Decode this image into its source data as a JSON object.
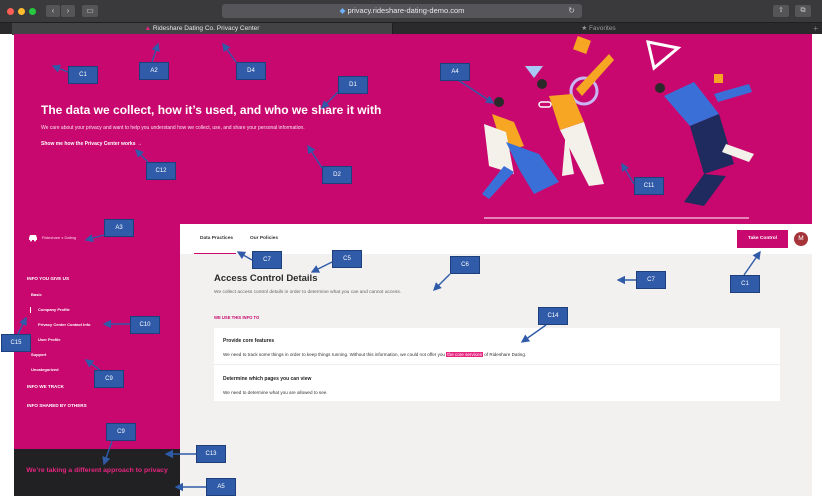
{
  "browser": {
    "url": "privacy.rideshare-dating-demo.com",
    "tab_title": "Rideshare Dating Co. Privacy Center",
    "favorites_label": "Favorites",
    "colors": {
      "chrome": "#3a3a3c",
      "tabbar": "#2a2a2c"
    }
  },
  "theme": {
    "brand": "#c8086e",
    "dark": "#212124",
    "panel": "#f3f1ef",
    "badge": "#2f5ba8"
  },
  "hero": {
    "title": "The data we collect, how it’s used, and who we share it with",
    "subtitle": "We care about your privacy and want to help you understand how we collect, use, and share your personal information.",
    "link": "Show me how the Privacy Center works →"
  },
  "sidebar": {
    "brand": "Rideshare x Dating",
    "sections": [
      {
        "label": "INFO YOU GIVE US"
      },
      {
        "label": "INFO WE TRACK"
      },
      {
        "label": "INFO SHARED BY OTHERS"
      }
    ],
    "items": [
      {
        "label": "Basic"
      },
      {
        "label": "Company Profile"
      },
      {
        "label": "Privacy Center Contact Info"
      },
      {
        "label": "User Profile"
      },
      {
        "label": "Support"
      },
      {
        "label": "Uncategorized"
      }
    ],
    "approach": "We’re taking a different approach to privacy"
  },
  "main": {
    "tabs": [
      {
        "label": "Data Practices",
        "active": true
      },
      {
        "label": "Our Policies",
        "active": false
      }
    ],
    "take_control": "Take Control",
    "avatar_letter": "M",
    "section_title": "Access Control Details",
    "section_desc": "We collect access control details in order to determine what you can and cannot access.",
    "we_use_label": "WE USE THIS INFO TO",
    "uses": [
      {
        "title": "Provide core features",
        "text_before": "We need to track some things in order to keep things running. Without this information, we could not offer you ",
        "highlight": "the core services",
        "text_after": " of Rideshare Dating."
      },
      {
        "title": "Determine which pages you can view",
        "text": "We need to determine what you are allowed to see."
      }
    ]
  },
  "annotations": [
    "C1",
    "A2",
    "D4",
    "D1",
    "A4",
    "C12",
    "D2",
    "C11",
    "A3",
    "C7",
    "C5",
    "C6",
    "C7",
    "C1",
    "C14",
    "C10",
    "C15",
    "C9",
    "C9",
    "C13",
    "A5"
  ]
}
